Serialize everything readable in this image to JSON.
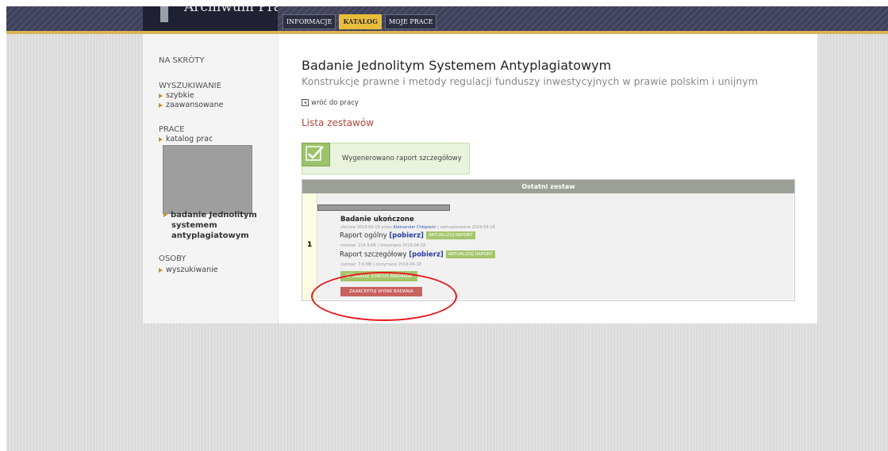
{
  "header": {
    "logo_text": "Archiwum Prac",
    "tabs": [
      {
        "label": "INFORMACJE",
        "active": false
      },
      {
        "label": "KATALOG",
        "active": true
      },
      {
        "label": "MOJE PRACE",
        "active": false
      }
    ]
  },
  "sidebar": {
    "section_shortcuts": "NA SKRÓTY",
    "section_search": "WYSZUKIWANIE",
    "search_items": [
      "szybkie",
      "zaawansowane"
    ],
    "section_works": "PRACE",
    "works_items": [
      "katalog prac"
    ],
    "current_item": [
      "badanie Jednolitym",
      "systemem",
      "antyplagiatowym"
    ],
    "section_people": "OSOBY",
    "people_items": [
      "wyszukiwanie"
    ]
  },
  "main": {
    "title": "Badanie Jednolitym Systemem Antyplagiatowym",
    "subtitle": "Konstrukcje prawne i metody regulacji funduszy inwestycyjnych w prawie polskim i unijnym",
    "back_link": "wróć do pracy",
    "list_title": "Lista zestawów",
    "success_message": "Wygenerowano raport szczegółowy",
    "table_header": "Ostatni zestaw",
    "row_number": "1",
    "status": "Badanie ukończone",
    "ordered_text": "zlecone 2019-04-18 przez",
    "ordered_by": "Aleksander Chłopecki",
    "updated_text": "| zaktualizowane 2019-04-18",
    "report_general": {
      "label": "Raport ogólny",
      "download": "[pobierz]",
      "button": "AKTUALIZUJ RAPORT",
      "meta": "rozmiar: 214.9 KB | otrzymano 2019-04-18"
    },
    "report_detailed": {
      "label": "Raport szczegółowy",
      "download": "[pobierz]",
      "button": "AKTUALIZUJ RAPORT",
      "meta": "rozmiar: 7.6 MB | otrzymano 2019-04-18"
    },
    "status_button": "SPRAWDŹ STATUS BADANIA",
    "accept_button": "ZAAKCEPTUJ WYNIK BADANIA"
  },
  "colors": {
    "accent_tab": "#e9bd3c",
    "header_border": "#d8b456",
    "green_button": "#a5c56d",
    "red_button": "#c8625e",
    "annotation_circle": "#e8161a"
  }
}
